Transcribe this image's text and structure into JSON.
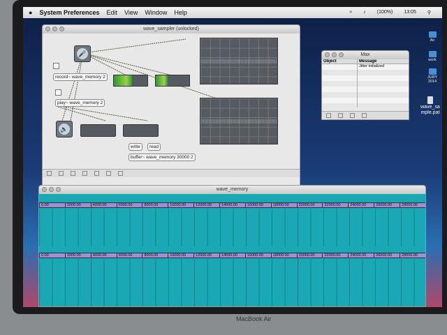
{
  "menubar": {
    "apple": "",
    "app": "System Preferences",
    "items": [
      "Edit",
      "View",
      "Window",
      "Help"
    ],
    "battery": "(100%)",
    "clock": "13:05"
  },
  "patch": {
    "title": "wave_sampler (unlocked)",
    "objects": {
      "record": "record~ wave_memory 2",
      "play": "play~ wave_memory 2",
      "write": "write",
      "read": "read",
      "buffer": "buffer~ wave_memory 30000 2"
    }
  },
  "max_window": {
    "title": "Max",
    "columns": [
      "Object",
      "Message"
    ],
    "rows": [
      {
        "object": "",
        "message": "Jitter initialized"
      }
    ]
  },
  "buffer_window": {
    "title": "wave_memory",
    "ruler": [
      "0.00",
      "2000.00",
      "4000.00",
      "6000.00",
      "8000.00",
      "10000.00",
      "12000.00",
      "14000.00",
      "16000.00",
      "18000.00",
      "20000.00",
      "22000.00",
      "24000.00",
      "26000.00",
      "28000.00"
    ]
  },
  "desktop": {
    "icons": [
      "Air",
      "work",
      "JURY 2014",
      "wave_sample.pat"
    ]
  },
  "hardware": {
    "label": "MacBook Air"
  },
  "meters": {
    "left_level": 0.55,
    "right_level": 0.35
  }
}
